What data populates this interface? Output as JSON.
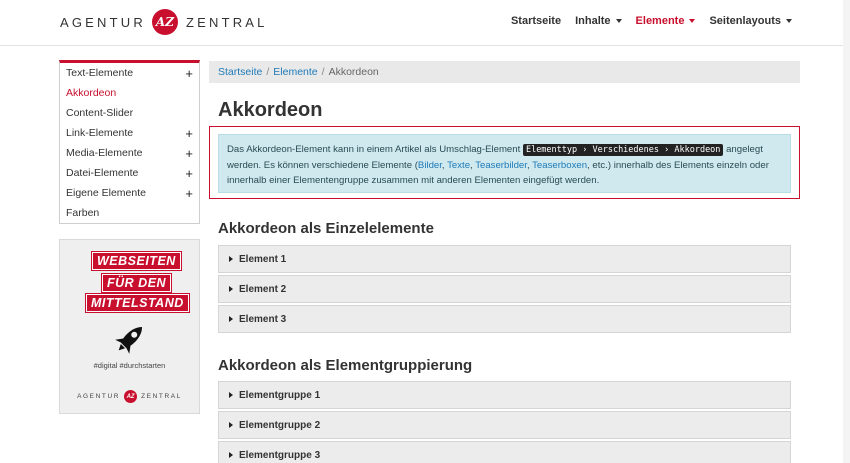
{
  "header": {
    "logo_left": "AGENTUR",
    "logo_mark": "AZ",
    "logo_right": "ZENTRAL",
    "nav": [
      {
        "label": "Startseite",
        "dropdown": false,
        "active": false
      },
      {
        "label": "Inhalte",
        "dropdown": true,
        "active": false
      },
      {
        "label": "Elemente",
        "dropdown": true,
        "active": true
      },
      {
        "label": "Seitenlayouts",
        "dropdown": true,
        "active": false
      }
    ]
  },
  "sidebar": {
    "items": [
      {
        "label": "Text-Elemente",
        "expandable": true
      },
      {
        "label": "Akkordeon",
        "expandable": false,
        "active": true
      },
      {
        "label": "Content-Slider",
        "expandable": false
      },
      {
        "label": "Link-Elemente",
        "expandable": true
      },
      {
        "label": "Media-Elemente",
        "expandable": true
      },
      {
        "label": "Datei-Elemente",
        "expandable": true
      },
      {
        "label": "Eigene Elemente",
        "expandable": true
      },
      {
        "label": "Farben",
        "expandable": false
      }
    ],
    "expand_symbol": "+",
    "promo": {
      "line1": "WEBSEITEN",
      "line2": "FÜR DEN",
      "line3": "MITTELSTAND",
      "tagline": "#digital #durchstarten",
      "logo_left": "AGENTUR",
      "logo_mark": "AZ",
      "logo_right": "ZENTRAL"
    }
  },
  "breadcrumb": {
    "items": [
      "Startseite",
      "Elemente"
    ],
    "current": "Akkordeon",
    "separator": "/"
  },
  "main": {
    "title": "Akkordeon",
    "info": {
      "text1": "Das Akkordeon-Element kann in einem Artikel als Umschlag-Element ",
      "code": "Elementtyp › Verschiedenes › Akkordeon",
      "text2": " angelegt werden. Es können verschiedene Elemente (",
      "link1": "Bilder",
      "comma1": ", ",
      "link2": "Texte",
      "comma2": ", ",
      "link3": "Teaserbilder",
      "comma3": ", ",
      "link4": "Teaserboxen",
      "text3": ", etc.) innerhalb des Elements einzeln oder innerhalb einer Elementengruppe zusammen mit anderen Elementen eingefügt werden."
    },
    "section1": {
      "title": "Akkordeon als Einzelelemente",
      "items": [
        "Element 1",
        "Element 2",
        "Element 3"
      ]
    },
    "section2": {
      "title": "Akkordeon als Elementgruppierung",
      "items": [
        "Elementgruppe 1",
        "Elementgruppe 2",
        "Elementgruppe 3"
      ]
    }
  },
  "colors": {
    "brand_red": "#c8102e",
    "link_blue": "#1f7ab8",
    "info_bg": "#cfe9ee"
  }
}
